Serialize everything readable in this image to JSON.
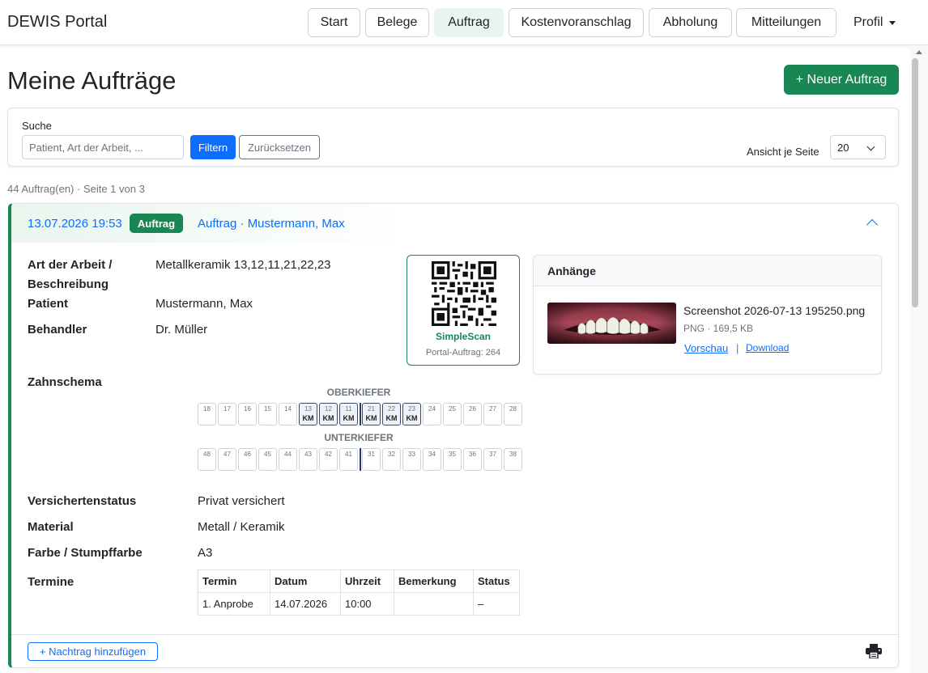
{
  "app": {
    "brand": "DEWIS Portal"
  },
  "nav": {
    "items": [
      {
        "label": "Start"
      },
      {
        "label": "Belege"
      },
      {
        "label": "Auftrag"
      },
      {
        "label": "Kostenvoranschlag"
      },
      {
        "label": "Abholung"
      },
      {
        "label": "Mitteilungen"
      }
    ],
    "active": "Auftrag",
    "profile_label": "Profil"
  },
  "page": {
    "title": "Meine Aufträge",
    "new_button": "+ Neuer Auftrag",
    "count_text": "44 Auftrag(en) · Seite 1 von 3"
  },
  "filter": {
    "search_label": "Suche",
    "search_placeholder": "Patient, Art der Arbeit, ...",
    "filter_button": "Filtern",
    "reset_button": "Zurücksetzen",
    "per_page_label": "Ansicht je Seite",
    "per_page_value": "20"
  },
  "order": {
    "datetime": "13.07.2026 19:53",
    "badge": "Auftrag",
    "title": "Auftrag · Mustermann, Max",
    "fields": {
      "art_label": "Art der Arbeit / Beschreibung",
      "art_value": "Metallkeramik 13,12,11,21,22,23",
      "patient_label": "Patient",
      "patient_value": "Mustermann, Max",
      "behandler_label": "Behandler",
      "behandler_value": "Dr. Müller",
      "zahnschema_label": "Zahnschema",
      "versicherung_label": "Versichertenstatus",
      "versicherung_value": "Privat versichert",
      "material_label": "Material",
      "material_value": "Metall / Keramik",
      "farbe_label": "Farbe / Stumpffarbe",
      "farbe_value": "A3",
      "termine_label": "Termine"
    },
    "qr": {
      "name": "SimpleScan",
      "subtitle": "Portal-Auftrag: 264"
    },
    "attachments": {
      "title": "Anhänge",
      "file_name": "Screenshot 2026-07-13 195250.png",
      "file_meta": "PNG · 169,5 KB",
      "preview_link": "Vorschau",
      "separator": "|",
      "download_link": "Download"
    },
    "tooth_chart": {
      "upper_label": "OBERKIEFER",
      "lower_label": "UNTERKIEFER",
      "upper": [
        {
          "n": "18",
          "code": ""
        },
        {
          "n": "17",
          "code": ""
        },
        {
          "n": "16",
          "code": ""
        },
        {
          "n": "15",
          "code": ""
        },
        {
          "n": "14",
          "code": ""
        },
        {
          "n": "13",
          "code": "KM"
        },
        {
          "n": "12",
          "code": "KM"
        },
        {
          "n": "11",
          "code": "KM"
        },
        {
          "n": "21",
          "code": "KM"
        },
        {
          "n": "22",
          "code": "KM"
        },
        {
          "n": "23",
          "code": "KM"
        },
        {
          "n": "24",
          "code": ""
        },
        {
          "n": "25",
          "code": ""
        },
        {
          "n": "26",
          "code": ""
        },
        {
          "n": "27",
          "code": ""
        },
        {
          "n": "28",
          "code": ""
        }
      ],
      "lower": [
        {
          "n": "48",
          "code": ""
        },
        {
          "n": "47",
          "code": ""
        },
        {
          "n": "46",
          "code": ""
        },
        {
          "n": "45",
          "code": ""
        },
        {
          "n": "44",
          "code": ""
        },
        {
          "n": "43",
          "code": ""
        },
        {
          "n": "42",
          "code": ""
        },
        {
          "n": "41",
          "code": ""
        },
        {
          "n": "31",
          "code": ""
        },
        {
          "n": "32",
          "code": ""
        },
        {
          "n": "33",
          "code": ""
        },
        {
          "n": "34",
          "code": ""
        },
        {
          "n": "35",
          "code": ""
        },
        {
          "n": "36",
          "code": ""
        },
        {
          "n": "37",
          "code": ""
        },
        {
          "n": "38",
          "code": ""
        }
      ]
    },
    "termine": {
      "headers": [
        "Termin",
        "Datum",
        "Uhrzeit",
        "Bemerkung",
        "Status"
      ],
      "rows": [
        [
          "1. Anprobe",
          "14.07.2026",
          "10:00",
          "",
          "–"
        ]
      ]
    },
    "add_supplement_button": "+ Nachtrag hinzufügen",
    "print_icon": "printer-icon"
  },
  "colors": {
    "primary": "#0d6efd",
    "success": "#198754",
    "muted": "#6c757d"
  }
}
